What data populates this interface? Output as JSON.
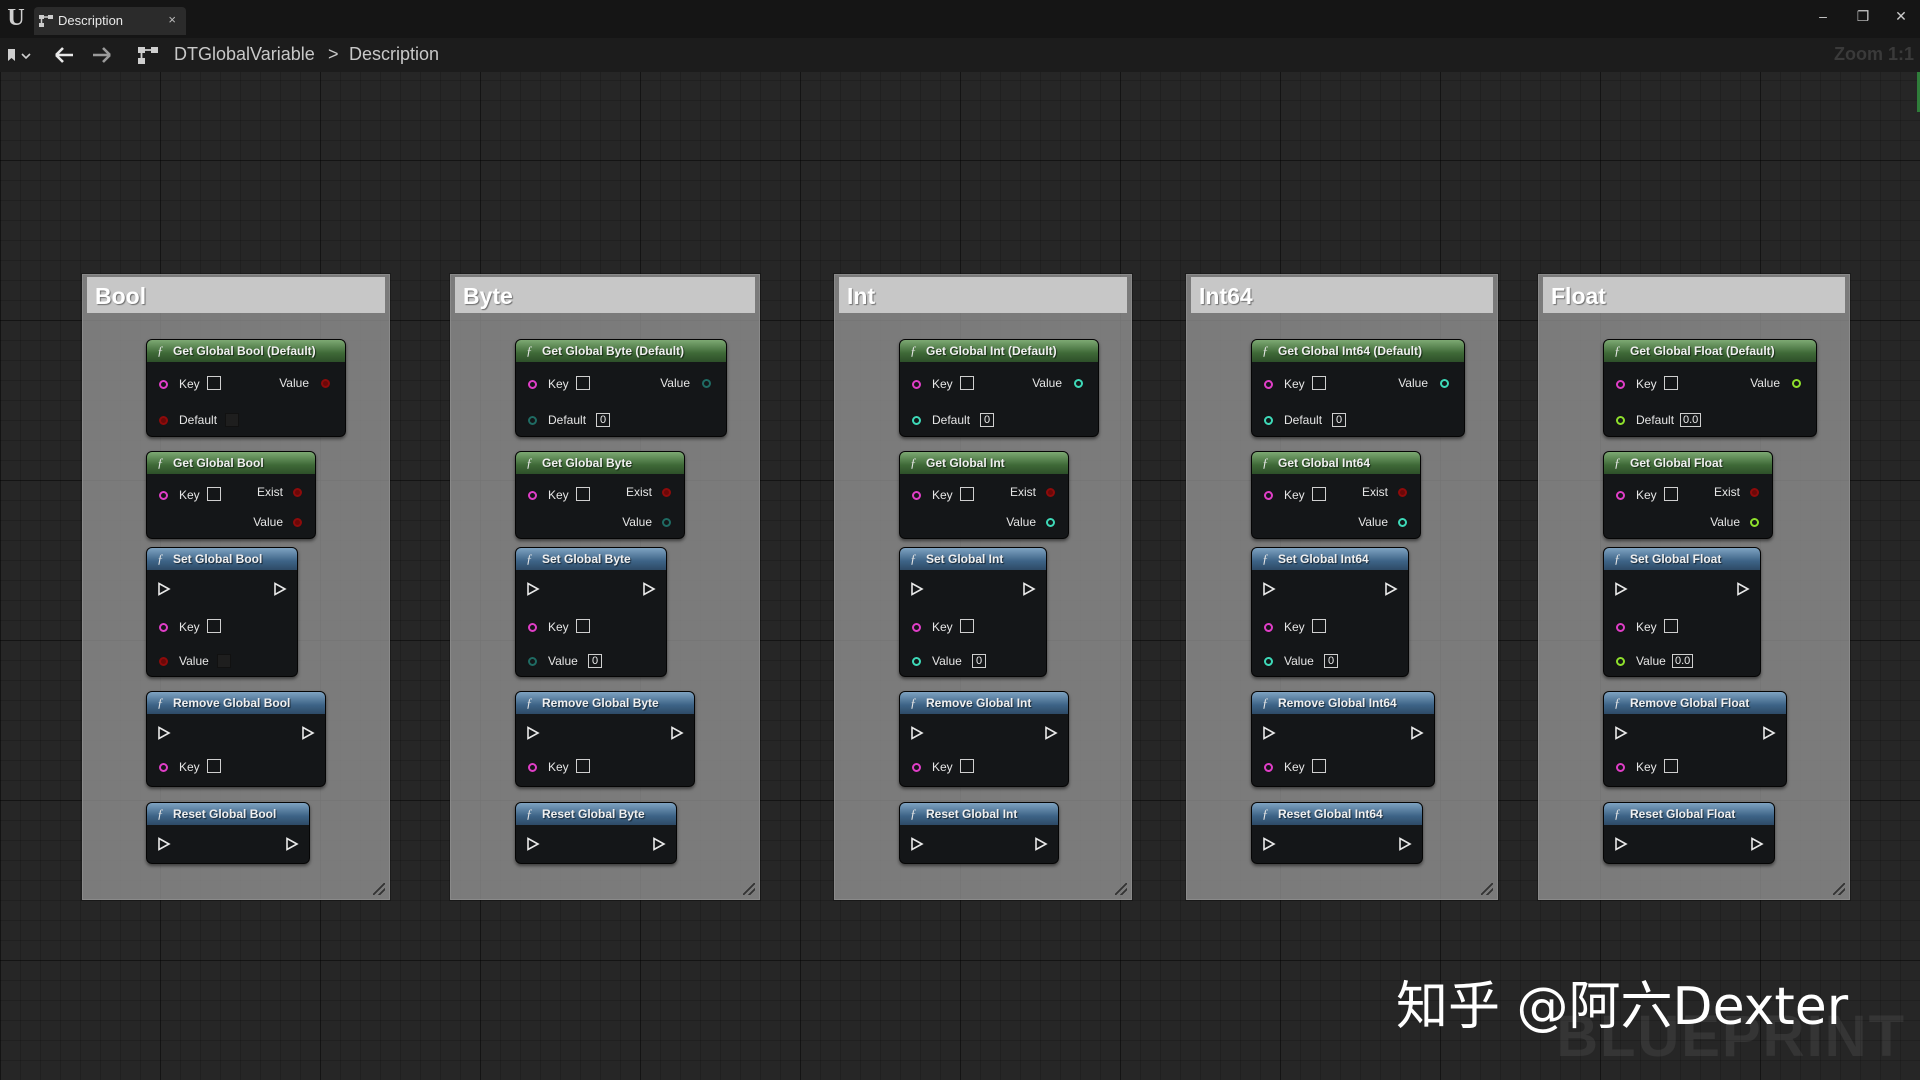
{
  "window": {
    "tab_title": "Description",
    "tab_close": "×",
    "min": "–",
    "restore": "❐",
    "close": "✕"
  },
  "nav": {
    "breadcrumb_root": "DTGlobalVariable",
    "breadcrumb_sep": ">",
    "breadcrumb_current": "Description",
    "zoom": "Zoom 1:1"
  },
  "groups": [
    {
      "title": "Bool",
      "type": "bool",
      "get_default": {
        "title": "Get Global Bool (Default)",
        "key": "Key",
        "value": "Value",
        "default": "Default"
      },
      "get": {
        "title": "Get Global Bool",
        "key": "Key",
        "exist": "Exist",
        "value": "Value"
      },
      "set": {
        "title": "Set Global Bool",
        "key": "Key",
        "value": "Value"
      },
      "remove": {
        "title": "Remove Global Bool",
        "key": "Key"
      },
      "reset": {
        "title": "Reset Global Bool"
      }
    },
    {
      "title": "Byte",
      "type": "byte",
      "get_default": {
        "title": "Get Global Byte (Default)",
        "key": "Key",
        "value": "Value",
        "default": "Default",
        "default_val": "0"
      },
      "get": {
        "title": "Get Global Byte",
        "key": "Key",
        "exist": "Exist",
        "value": "Value"
      },
      "set": {
        "title": "Set Global Byte",
        "key": "Key",
        "value": "Value",
        "value_val": "0"
      },
      "remove": {
        "title": "Remove Global Byte",
        "key": "Key"
      },
      "reset": {
        "title": "Reset Global Byte"
      }
    },
    {
      "title": "Int",
      "type": "int",
      "get_default": {
        "title": "Get Global Int (Default)",
        "key": "Key",
        "value": "Value",
        "default": "Default",
        "default_val": "0"
      },
      "get": {
        "title": "Get Global Int",
        "key": "Key",
        "exist": "Exist",
        "value": "Value"
      },
      "set": {
        "title": "Set Global Int",
        "key": "Key",
        "value": "Value",
        "value_val": "0"
      },
      "remove": {
        "title": "Remove Global Int",
        "key": "Key"
      },
      "reset": {
        "title": "Reset Global Int"
      }
    },
    {
      "title": "Int64",
      "type": "int",
      "get_default": {
        "title": "Get Global Int64 (Default)",
        "key": "Key",
        "value": "Value",
        "default": "Default",
        "default_val": "0"
      },
      "get": {
        "title": "Get Global Int64",
        "key": "Key",
        "exist": "Exist",
        "value": "Value"
      },
      "set": {
        "title": "Set Global Int64",
        "key": "Key",
        "value": "Value",
        "value_val": "0"
      },
      "remove": {
        "title": "Remove Global Int64",
        "key": "Key"
      },
      "reset": {
        "title": "Reset Global Int64"
      }
    },
    {
      "title": "Float",
      "type": "float",
      "get_default": {
        "title": "Get Global Float (Default)",
        "key": "Key",
        "value": "Value",
        "default": "Default",
        "default_val": "0.0"
      },
      "get": {
        "title": "Get Global Float",
        "key": "Key",
        "exist": "Exist",
        "value": "Value"
      },
      "set": {
        "title": "Set Global Float",
        "key": "Key",
        "value": "Value",
        "value_val": "0.0"
      },
      "remove": {
        "title": "Remove Global Float",
        "key": "Key"
      },
      "reset": {
        "title": "Reset Global Float"
      }
    }
  ],
  "watermark": "知乎 @阿六Dexter",
  "graph_label": "BLUEPRINT",
  "colors": {
    "key_pin": "#e03ec7",
    "bool_pin": "#8e0b0b",
    "byte_pin": "#1f6b63",
    "int_pin": "#3ed9b8",
    "float_pin": "#8fe02c",
    "pure_header": "#3e6937",
    "impure_header": "#3d6386"
  }
}
